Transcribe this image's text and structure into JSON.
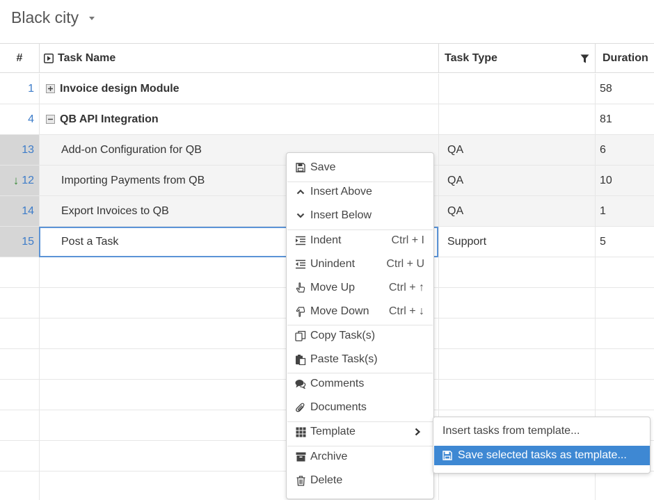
{
  "project": {
    "title": "Black city"
  },
  "grid": {
    "columns": {
      "num": "#",
      "name": "Task Name",
      "type": "Task Type",
      "duration": "Duration"
    },
    "rows": [
      {
        "num": "1",
        "name": "Invoice design Module",
        "type": "",
        "duration": "58"
      },
      {
        "num": "4",
        "name": "QB API Integration",
        "type": "",
        "duration": "81"
      },
      {
        "num": "13",
        "name": "Add-on Configuration for QB",
        "type": "QA",
        "duration": "6"
      },
      {
        "num": "12",
        "name": "Importing Payments from QB",
        "type": "QA",
        "duration": "10"
      },
      {
        "num": "14",
        "name": "Export Invoices to QB",
        "type": "QA",
        "duration": "1"
      },
      {
        "num": "15",
        "name": "Post a Task",
        "type": "Support",
        "duration": "5"
      }
    ]
  },
  "context_menu": {
    "save": "Save",
    "insert_above": "Insert Above",
    "insert_below": "Insert Below",
    "indent": "Indent",
    "indent_shortcut": "Ctrl + I",
    "unindent": "Unindent",
    "unindent_shortcut": "Ctrl + U",
    "move_up": "Move Up",
    "move_up_shortcut": "Ctrl + ↑",
    "move_down": "Move Down",
    "move_down_shortcut": "Ctrl + ↓",
    "copy_tasks": "Copy Task(s)",
    "paste_tasks": "Paste Task(s)",
    "comments": "Comments",
    "documents": "Documents",
    "template": "Template",
    "archive": "Archive",
    "delete": "Delete"
  },
  "template_submenu": {
    "insert_from_template": "Insert tasks from template...",
    "save_as_template": "Save selected tasks as template..."
  },
  "colors": {
    "accent": "#3e88d3",
    "row_number": "#3d7cc9",
    "selected_row_bg": "#d6d6d6",
    "move_arrow": "#3a8a3a"
  }
}
